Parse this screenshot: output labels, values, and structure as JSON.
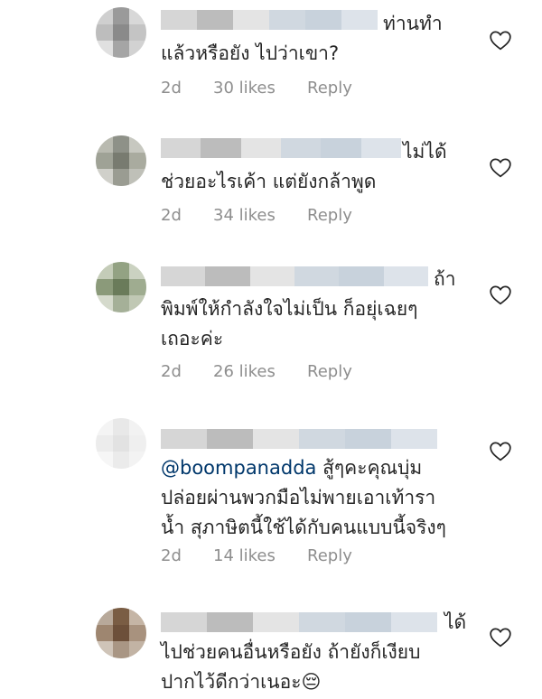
{
  "comments": [
    {
      "name_suffix": "ท่านทำ",
      "text": "แล้วหรือยัง ไปว่าเขา?",
      "age": "2d",
      "likes": "30 likes",
      "reply": "Reply"
    },
    {
      "name_suffix": "ไม่ได้",
      "text": "ช่วยอะไรเค้า แต่ยังกล้าพูด",
      "age": "2d",
      "likes": "34 likes",
      "reply": "Reply"
    },
    {
      "name_suffix": "ถ้า",
      "text": "พิมพ์ให้กำลังใจไม่เป็น ก็อยุ่เฉยๆ\nเถอะค่ะ",
      "age": "2d",
      "likes": "26 likes",
      "reply": "Reply"
    },
    {
      "name_suffix": "",
      "mention": "@boompanadda",
      "text_after_mention": " สู้ๆคะคุณบุ่ม",
      "text": "ปล่อยผ่านพวกมือไม่พายเอาเท้ารา\nน้ำ สุภาษิตนี้ใช้ได้กับคนแบบนี้จริงๆ",
      "age": "2d",
      "likes": "14 likes",
      "reply": "Reply"
    },
    {
      "name_suffix": "ได้",
      "text": "ไปช่วยคนอื่นหรือยัง ถ้ายังก็เงียบ\nปากไว้ดีกว่าเนอะ😔",
      "age": "",
      "likes": "",
      "reply": ""
    }
  ],
  "colors": {
    "meta": "#8e8e8e",
    "mention": "#00376b",
    "text": "#262626"
  },
  "icons": {
    "like": "heart-outline-icon"
  }
}
